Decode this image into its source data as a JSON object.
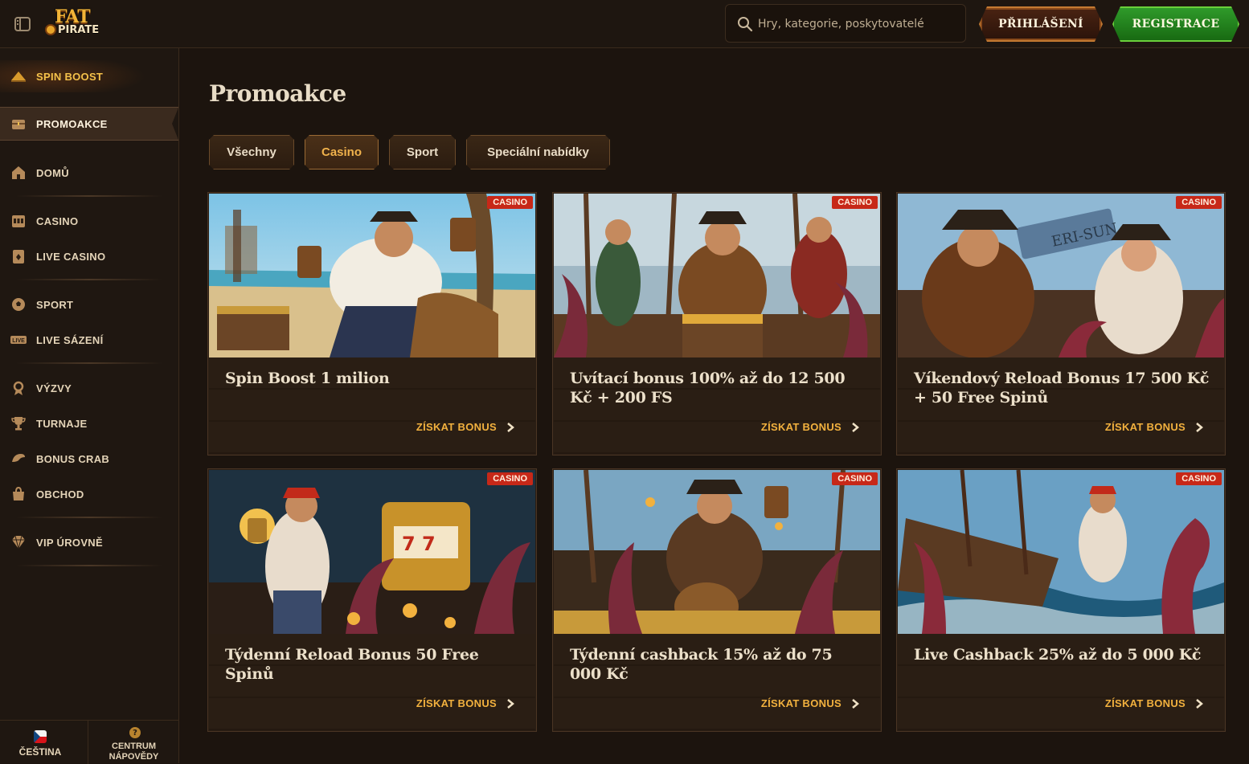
{
  "header": {
    "logo_top": "FAT",
    "logo_bottom": "PIRATE",
    "search_placeholder": "Hry, kategorie, poskytovatelé",
    "login_label": "PŘIHLÁŠENÍ",
    "register_label": "REGISTRACE"
  },
  "sidebar": {
    "items": [
      {
        "label": "SPIN BOOST",
        "icon": "spin-boost-icon"
      },
      {
        "label": "PROMOAKCE",
        "icon": "treasure-chest-icon"
      },
      {
        "label": "DOMŮ",
        "icon": "home-icon"
      },
      {
        "label": "CASINO",
        "icon": "casino-icon"
      },
      {
        "label": "LIVE CASINO",
        "icon": "live-casino-icon"
      },
      {
        "label": "SPORT",
        "icon": "sport-ball-icon"
      },
      {
        "label": "LIVE SÁZENÍ",
        "icon": "live-betting-icon"
      },
      {
        "label": "VÝZVY",
        "icon": "challenges-icon"
      },
      {
        "label": "TURNAJE",
        "icon": "trophy-icon"
      },
      {
        "label": "BONUS CRAB",
        "icon": "crab-icon"
      },
      {
        "label": "OBCHOD",
        "icon": "shop-bag-icon"
      },
      {
        "label": "VIP ÚROVNĚ",
        "icon": "vip-gem-icon"
      }
    ],
    "footer": {
      "language_label": "ČEŠTINA",
      "help_label": "CENTRUM NÁPOVĚDY"
    }
  },
  "main": {
    "title": "Promoakce",
    "filters": [
      {
        "label": "Všechny",
        "active": false
      },
      {
        "label": "Casino",
        "active": true
      },
      {
        "label": "Sport",
        "active": false
      },
      {
        "label": "Speciální nabídky",
        "active": false
      }
    ],
    "cards": [
      {
        "badge": "CASINO",
        "title": "Spin Boost 1 milion",
        "cta": "ZÍSKAT BONUS"
      },
      {
        "badge": "CASINO",
        "title": "Uvítací bonus 100% až do 12 500 Kč + 200 FS",
        "cta": "ZÍSKAT BONUS"
      },
      {
        "badge": "CASINO",
        "title": "Víkendový Reload Bonus 17 500 Kč + 50 Free Spinů",
        "cta": "ZÍSKAT BONUS"
      },
      {
        "badge": "CASINO",
        "title": "Týdenní Reload Bonus 50 Free Spinů",
        "cta": "ZÍSKAT BONUS"
      },
      {
        "badge": "CASINO",
        "title": "Týdenní cashback 15% až do 75 000 Kč",
        "cta": "ZÍSKAT BONUS"
      },
      {
        "badge": "CASINO",
        "title": "Live Cashback 25% až do 5 000 Kč",
        "cta": "ZÍSKAT BONUS"
      }
    ]
  },
  "colors": {
    "background": "#1c140e",
    "accent_gold": "#f2b13e",
    "badge_red": "#c72818",
    "register_green": "#2f9a2a"
  }
}
